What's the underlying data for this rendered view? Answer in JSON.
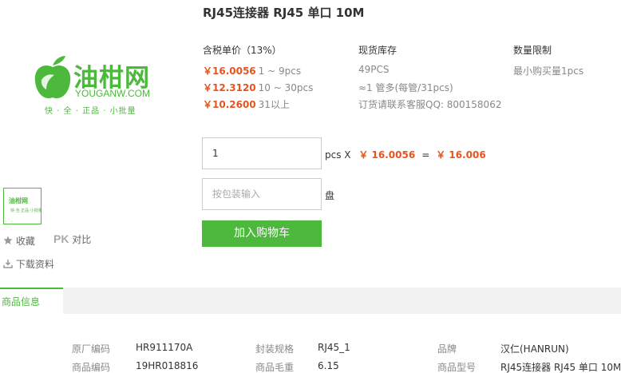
{
  "product": {
    "title": "RJ45连接器 RJ45 单口 10M"
  },
  "logo": {
    "name_cn": "油柑网",
    "name_en": "YOUGANW.COM",
    "slogan": "快 · 全 · 正品 · 小批量",
    "thumb_cn": "油柑网",
    "thumb_sub": "快·全·正品·小批量"
  },
  "sidebar": {
    "favorite_label": "收藏",
    "pk_label": "PK",
    "compare_label": "对比",
    "download_label": "下载资料"
  },
  "pricing": {
    "header": "含税单价（13%）",
    "tiers": [
      {
        "price": "￥16.0056",
        "range": "1 ~ 9pcs"
      },
      {
        "price": "￥12.3120",
        "range": "10 ~ 30pcs"
      },
      {
        "price": "￥10.2600",
        "range": "31以上"
      }
    ]
  },
  "stock": {
    "header": "现货库存",
    "qty": "49PCS",
    "pack": "≈1 管多(每管/31pcs)",
    "contact": "订货请联系客服QQ: 800158062"
  },
  "limit": {
    "header": "数量限制",
    "min": "最小购买量1pcs"
  },
  "order": {
    "qty_value": "1",
    "unit_text": "pcs X",
    "unit_price": "￥ 16.0056",
    "equals": "=",
    "total": "￥ 16.006",
    "pkg_placeholder": "按包装输入",
    "pkg_unit": "盘",
    "cart_label": "加入购物车"
  },
  "tabs": {
    "active": "商品信息"
  },
  "specs": {
    "row1": [
      {
        "label": "原厂编码",
        "value": "HR911170A"
      },
      {
        "label": "封装规格",
        "value": "RJ45_1"
      },
      {
        "label": "品牌",
        "value": "汉仁(HANRUN)"
      }
    ],
    "row2": [
      {
        "label": "商品编码",
        "value": "19HR018816"
      },
      {
        "label": "商品毛重",
        "value": "6.15"
      },
      {
        "label": "商品型号",
        "value": "RJ45连接器 RJ45 单口 10M"
      }
    ]
  },
  "colors": {
    "brand_green": "#4cb83c",
    "price_orange": "#e8541e"
  }
}
